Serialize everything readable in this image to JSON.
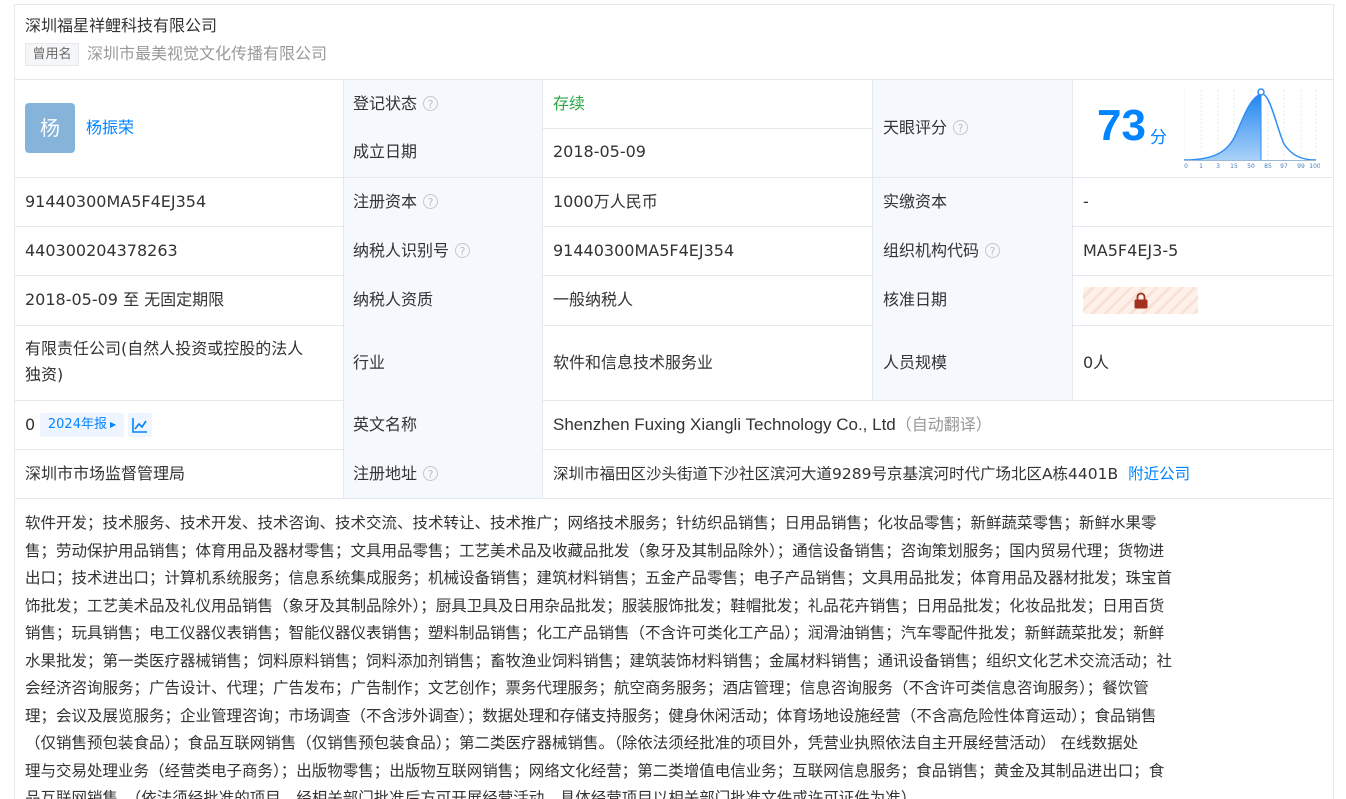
{
  "company": {
    "name": "深圳福星祥鲤科技有限公司",
    "former_label": "曾用名",
    "former_name": "深圳市最美视觉文化传播有限公司"
  },
  "legal_rep": {
    "avatar_char": "杨",
    "name": "杨振荣"
  },
  "labels": {
    "reg_status": "登记状态",
    "found_date": "成立日期",
    "tianyan_score": "天眼评分",
    "reg_capital": "注册资本",
    "paid_capital": "实缴资本",
    "taxpayer_id": "纳税人识别号",
    "org_code": "组织机构代码",
    "taxpayer_qual": "纳税人资质",
    "approve_date": "核准日期",
    "industry": "行业",
    "staff_size": "人员规模",
    "english_name": "英文名称",
    "reg_address": "注册地址",
    "question_mark": "?"
  },
  "values": {
    "reg_status": "存续",
    "found_date": "2018-05-09",
    "credit_code": "91440300MA5F4EJ354",
    "reg_capital": "1000万人民币",
    "paid_capital": "-",
    "reg_number": "440300204378263",
    "taxpayer_id": "91440300MA5F4EJ354",
    "org_code": "MA5F4EJ3-5",
    "business_term": "2018-05-09 至 无固定期限",
    "taxpayer_qual": "一般纳税人",
    "company_type_1": "有限责任公司(自然人投资或控股的法人",
    "company_type_2": "独资)",
    "industry": "软件和信息技术服务业",
    "staff_size": "0人",
    "insured_count": "0",
    "annual_report": "2024年报",
    "english_name": "Shenzhen Fuxing Xiangli Technology Co., Ltd",
    "auto_translate": "（自动翻译）",
    "authority": "深圳市市场监督管理局",
    "reg_address": "深圳市福田区沙头街道下沙社区滨河大道9289号京基滨河时代广场北区A栋4401B",
    "nearby": "附近公司"
  },
  "score": {
    "value": "73",
    "unit": "分",
    "axis_ticks": [
      "0",
      "1",
      "3",
      "15",
      "50",
      "85",
      "97",
      "99",
      "100"
    ],
    "colors": {
      "curve": "#2f8ef5",
      "value": "#0084ff"
    }
  },
  "business_scope": [
    "软件开发；技术服务、技术开发、技术咨询、技术交流、技术转让、技术推广；网络技术服务；针纺织品销售；日用品销售；化妆品零售；新鲜蔬菜零售；新鲜水果零",
    "售；劳动保护用品销售；体育用品及器材零售；文具用品零售；工艺美术品及收藏品批发（象牙及其制品除外）；通信设备销售；咨询策划服务；国内贸易代理；货物进",
    "出口；技术进出口；计算机系统服务；信息系统集成服务；机械设备销售；建筑材料销售；五金产品零售；电子产品销售；文具用品批发；体育用品及器材批发；珠宝首",
    "饰批发；工艺美术品及礼仪用品销售（象牙及其制品除外）；厨具卫具及日用杂品批发；服装服饰批发；鞋帽批发；礼品花卉销售；日用品批发；化妆品批发；日用百货",
    "销售；玩具销售；电工仪器仪表销售；智能仪器仪表销售；塑料制品销售；化工产品销售（不含许可类化工产品）；润滑油销售；汽车零配件批发；新鲜蔬菜批发；新鲜",
    "水果批发；第一类医疗器械销售；饲料原料销售；饲料添加剂销售；畜牧渔业饲料销售；建筑装饰材料销售；金属材料销售；通讯设备销售；组织文化艺术交流活动；社",
    "会经济咨询服务；广告设计、代理；广告发布；广告制作；文艺创作；票务代理服务；航空商务服务；酒店管理；信息咨询服务（不含许可类信息咨询服务）；餐饮管",
    "理；会议及展览服务；企业管理咨询；市场调查（不含涉外调查）；数据处理和存储支持服务；健身休闲活动；体育场地设施经营（不含高危险性体育运动）；食品销售",
    "（仅销售预包装食品）；食品互联网销售（仅销售预包装食品）；第二类医疗器械销售。（除依法须经批准的项目外，凭营业执照依法自主开展经营活动） 在线数据处",
    "理与交易处理业务（经营类电子商务）；出版物零售；出版物互联网销售；网络文化经营；第二类增值电信业务；互联网信息服务；食品销售；黄金及其制品进出口；食",
    "品互联网销售。（依法须经批准的项目，经相关部门批准后方可开展经营活动，具体经营项目以相关部门批准文件或许可证件为准）"
  ]
}
